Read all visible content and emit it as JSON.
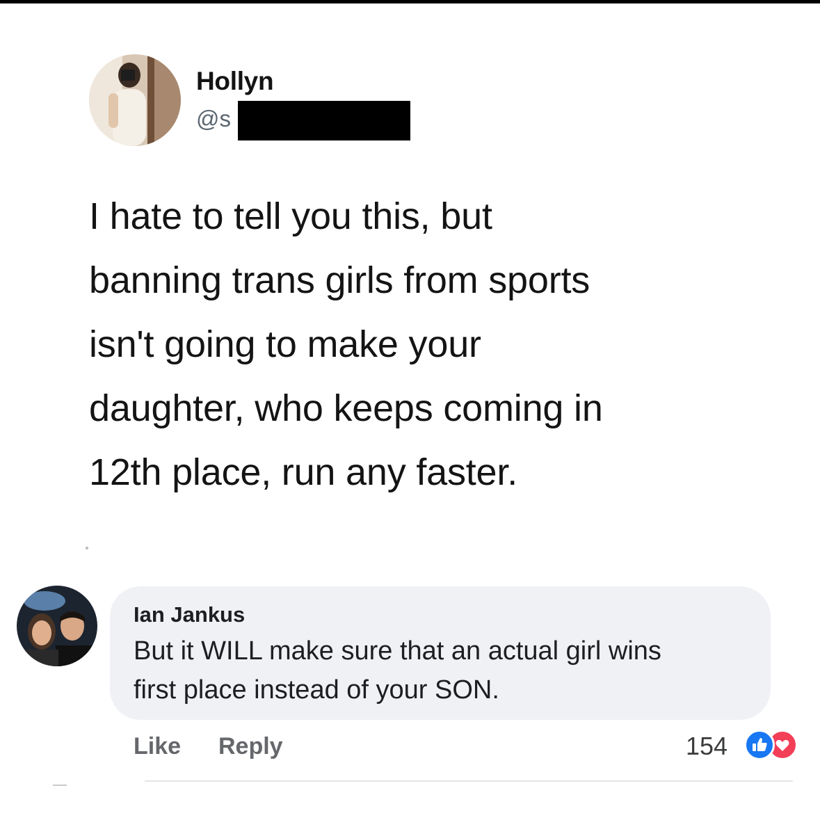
{
  "tweet": {
    "display_name": "Hollyn",
    "handle": "@s",
    "text": "I hate to tell you this, but\nbanning trans girls from sports\nisn't going to make your\ndaughter, who keeps coming in\n12th place, run any faster."
  },
  "comment": {
    "author": "Ian Jankus",
    "text": "But it WILL make sure that an actual girl wins\nfirst place instead of your SON.",
    "actions": {
      "like_label": "Like",
      "reply_label": "Reply"
    },
    "reaction_count": "154",
    "reactions": [
      "like-icon",
      "love-icon"
    ],
    "colors": {
      "bubble": "#eff1f4",
      "like_reaction": "#1877f2",
      "love_reaction": "#f33e58",
      "action_text": "#65676b"
    }
  }
}
